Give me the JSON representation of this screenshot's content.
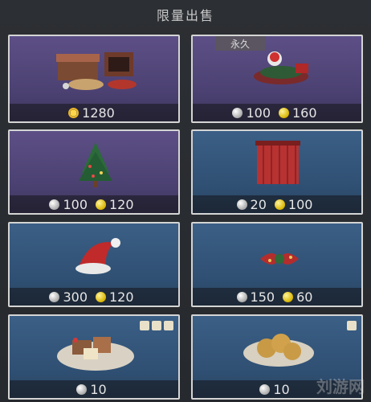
{
  "header": {
    "title": "限量出售"
  },
  "items": [
    {
      "name": "christmas-furniture-set",
      "badge": "",
      "prices": [
        {
          "currency": "sun-coin",
          "amount": "1280"
        }
      ]
    },
    {
      "name": "christmas-decor-bundle",
      "badge": "永久",
      "prices": [
        {
          "currency": "silver-apple",
          "amount": "100"
        },
        {
          "currency": "gold-apple",
          "amount": "160"
        }
      ]
    },
    {
      "name": "christmas-tree",
      "badge": "",
      "prices": [
        {
          "currency": "silver-apple",
          "amount": "100"
        },
        {
          "currency": "gold-apple",
          "amount": "120"
        }
      ]
    },
    {
      "name": "red-curtain",
      "badge": "",
      "prices": [
        {
          "currency": "silver-apple",
          "amount": "20"
        },
        {
          "currency": "gold-apple",
          "amount": "100"
        }
      ]
    },
    {
      "name": "santa-hat",
      "badge": "",
      "prices": [
        {
          "currency": "silver-apple",
          "amount": "300"
        },
        {
          "currency": "gold-apple",
          "amount": "120"
        }
      ]
    },
    {
      "name": "christmas-bow-ribbon",
      "badge": "",
      "prices": [
        {
          "currency": "silver-apple",
          "amount": "150"
        },
        {
          "currency": "gold-apple",
          "amount": "60"
        }
      ]
    },
    {
      "name": "christmas-cake-plate",
      "badge": "",
      "prices": [
        {
          "currency": "silver-apple",
          "amount": "10"
        }
      ]
    },
    {
      "name": "cookie-plate",
      "badge": "",
      "prices": [
        {
          "currency": "silver-apple",
          "amount": "10"
        }
      ]
    }
  ],
  "watermark": {
    "text": "刘游网"
  },
  "colors": {
    "purple_card": "#5d4f86",
    "blue_card": "#3b5f86",
    "gold": "#d8b400",
    "silver": "#a9a9a9"
  }
}
